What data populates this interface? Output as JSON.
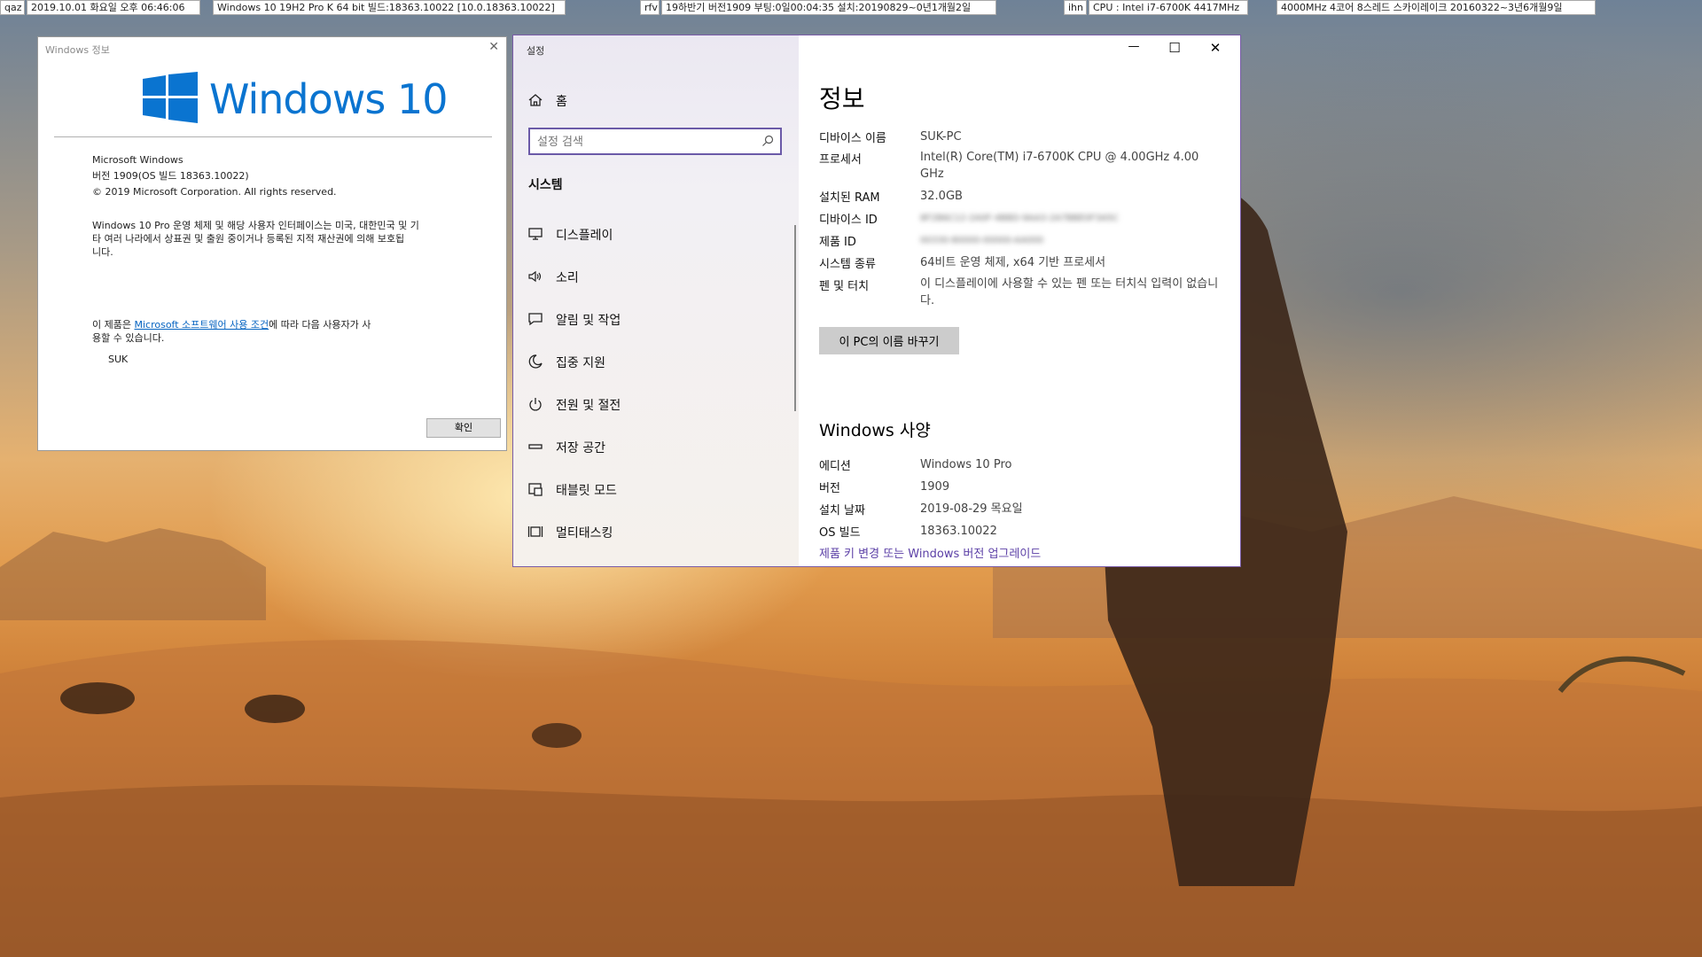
{
  "status_bar": {
    "items": [
      "qaz",
      "2019.10.01 화요일 오후 06:46:06",
      "Windows 10 19H2 Pro K 64 bit 빌드:18363.10022 [10.0.18363.10022]",
      "rfv",
      "19하반기 버전1909 부팅:0일00:04:35 설치:20190829~0년1개월2일",
      "ihn",
      "CPU : Intel i7-6700K 4417MHz",
      "4000MHz 4코어 8스레드 스카이레이크 20160322~3년6개월9일"
    ]
  },
  "about_dialog": {
    "title": "Windows 정보",
    "close_glyph": "✕",
    "logo_text": "Windows 10",
    "product": "Microsoft Windows",
    "version": "버전 1909(OS 빌드 18363.10022)",
    "copyright": "© 2019 Microsoft Corporation. All rights reserved.",
    "trademark_line1": "Windows 10 Pro 운영 체제 및 해당 사용자 인터페이스는 미국, 대한민국 및 기",
    "trademark_line2": "타 여러 나라에서 상표권 및 출원 중이거나 등록된 지적 재산권에 의해 보호됩",
    "trademark_line3": "니다.",
    "license_prefix": "이 제품은 ",
    "license_link": "Microsoft 소프트웨어 사용 조건",
    "license_suffix": "에 따라 다음 사용자가 사",
    "license_line2": "용할 수 있습니다.",
    "user": "SUK",
    "ok_label": "확인"
  },
  "settings": {
    "window_title": "설정",
    "controls": {
      "minimize": "—",
      "maximize": "☐",
      "close": "✕"
    },
    "nav": {
      "home_label": "홈",
      "search_placeholder": "설정 검색",
      "section_label": "시스템",
      "items": [
        {
          "label": "디스플레이",
          "icon": "display-icon"
        },
        {
          "label": "소리",
          "icon": "sound-icon"
        },
        {
          "label": "알림 및 작업",
          "icon": "notifications-icon"
        },
        {
          "label": "집중 지원",
          "icon": "focus-assist-icon"
        },
        {
          "label": "전원 및 절전",
          "icon": "power-icon"
        },
        {
          "label": "저장 공간",
          "icon": "storage-icon"
        },
        {
          "label": "태블릿 모드",
          "icon": "tablet-mode-icon"
        },
        {
          "label": "멀티태스킹",
          "icon": "multitasking-icon"
        }
      ]
    },
    "content": {
      "page_title": "정보",
      "device_specs": [
        {
          "label": "디바이스 이름",
          "value": "SUK-PC"
        },
        {
          "label": "프로세서",
          "value": "Intel(R) Core(TM) i7-6700K CPU @ 4.00GHz   4.00 GHz"
        },
        {
          "label": "설치된 RAM",
          "value": "32.0GB"
        },
        {
          "label": "디바이스 ID",
          "value": "8F2B6C12-2A0F-4BBD-9AA3-2A7BBE0F3A5C"
        },
        {
          "label": "제품 ID",
          "value": "00330-80000-00000-AA000"
        },
        {
          "label": "시스템 종류",
          "value": "64비트 운영 체제, x64 기반 프로세서"
        },
        {
          "label": "펜 및 터치",
          "value": "이 디스플레이에 사용할 수 있는 펜 또는 터치식 입력이 없습니다."
        }
      ],
      "rename_button": "이 PC의 이름 바꾸기",
      "windows_section_title": "Windows 사양",
      "windows_specs": [
        {
          "label": "에디션",
          "value": "Windows 10 Pro"
        },
        {
          "label": "버전",
          "value": "1909"
        },
        {
          "label": "설치 날짜",
          "value": "2019-08-29 목요일"
        },
        {
          "label": "OS 빌드",
          "value": "18363.10022"
        }
      ],
      "upgrade_link": "제품 키 변경 또는 Windows 버전 업그레이드"
    }
  },
  "colors": {
    "accent": "#6b5aa8",
    "link": "#0563c1",
    "windows_blue": "#0a74d0"
  }
}
